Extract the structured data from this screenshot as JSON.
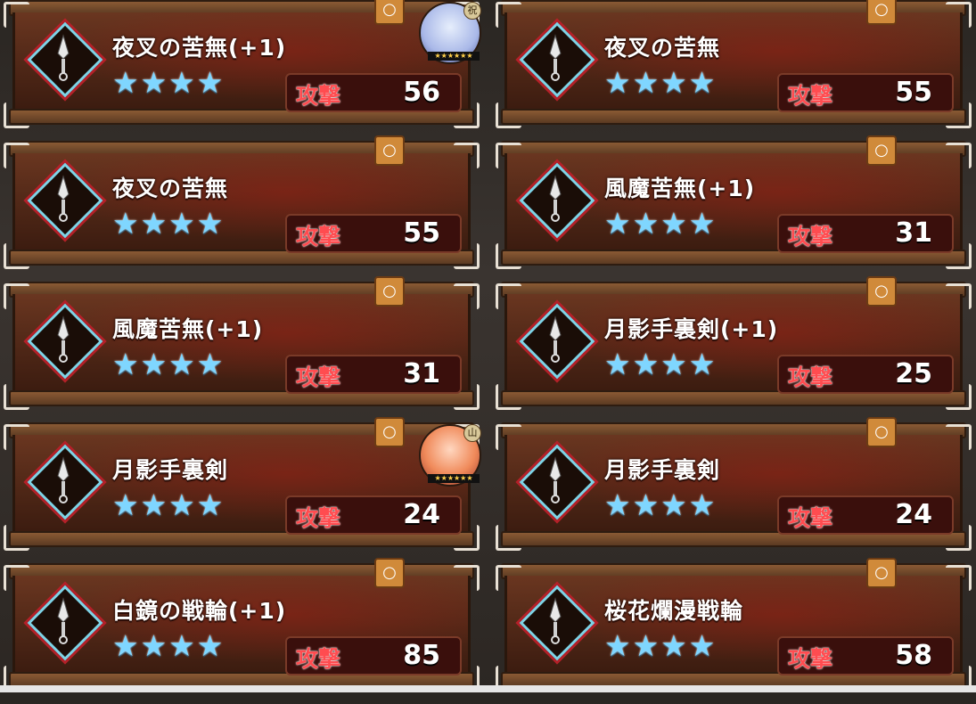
{
  "attack_label": "攻撃",
  "lock_icon": "padlock-icon",
  "star_glyph": "★",
  "colors": {
    "star": "#7fd6ff",
    "attack_label": "#ff4c50",
    "emblem_border": "#7ed3e6",
    "emblem_outline": "#b42028"
  },
  "cards": [
    {
      "name": "夜叉の苦無(+1)",
      "stars": 4,
      "attack": "56",
      "equipped_by": "silver-haired-character",
      "avatar_badge": "祝"
    },
    {
      "name": "夜叉の苦無",
      "stars": 4,
      "attack": "55"
    },
    {
      "name": "夜叉の苦無",
      "stars": 4,
      "attack": "55"
    },
    {
      "name": "風魔苦無(+1)",
      "stars": 4,
      "attack": "31"
    },
    {
      "name": "風魔苦無(+1)",
      "stars": 4,
      "attack": "31"
    },
    {
      "name": "月影手裏剣(+1)",
      "stars": 4,
      "attack": "25"
    },
    {
      "name": "月影手裏剣",
      "stars": 4,
      "attack": "24",
      "equipped_by": "orange-haired-character",
      "avatar_badge": "山"
    },
    {
      "name": "月影手裏剣",
      "stars": 4,
      "attack": "24"
    },
    {
      "name": "白鏡の戦輪(+1)",
      "stars": 4,
      "attack": "85"
    },
    {
      "name": "桜花爛漫戦輪",
      "stars": 4,
      "attack": "58"
    }
  ]
}
